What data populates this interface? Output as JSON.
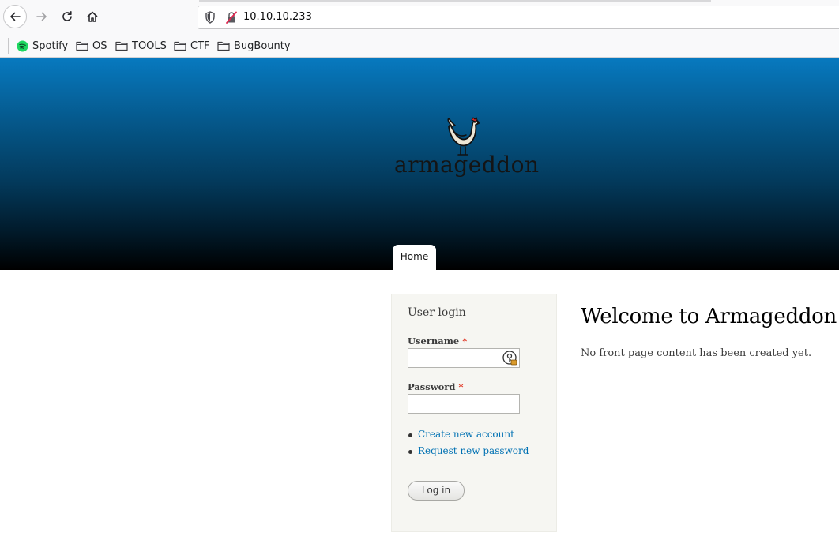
{
  "browser": {
    "url": "10.10.10.233",
    "bookmarks": [
      {
        "label": "Spotify",
        "icon": "spotify-icon"
      },
      {
        "label": "OS",
        "icon": "folder-icon"
      },
      {
        "label": "TOOLS",
        "icon": "folder-icon"
      },
      {
        "label": "CTF",
        "icon": "folder-icon"
      },
      {
        "label": "BugBounty",
        "icon": "folder-icon"
      }
    ]
  },
  "site": {
    "name": "armageddon",
    "logo_icon": "chicken-icon",
    "nav": {
      "home": "Home"
    }
  },
  "login": {
    "title": "User login",
    "username_label": "Username",
    "password_label": "Password",
    "required_marker": "*",
    "links": [
      "Create new account",
      "Request new password"
    ],
    "submit": "Log in"
  },
  "main": {
    "title": "Welcome to Armageddon",
    "body": "No front page content has been created yet."
  },
  "colors": {
    "header_top": "#0779bf",
    "header_bottom": "#000000",
    "link": "#0071b3",
    "required": "#e0301e"
  }
}
